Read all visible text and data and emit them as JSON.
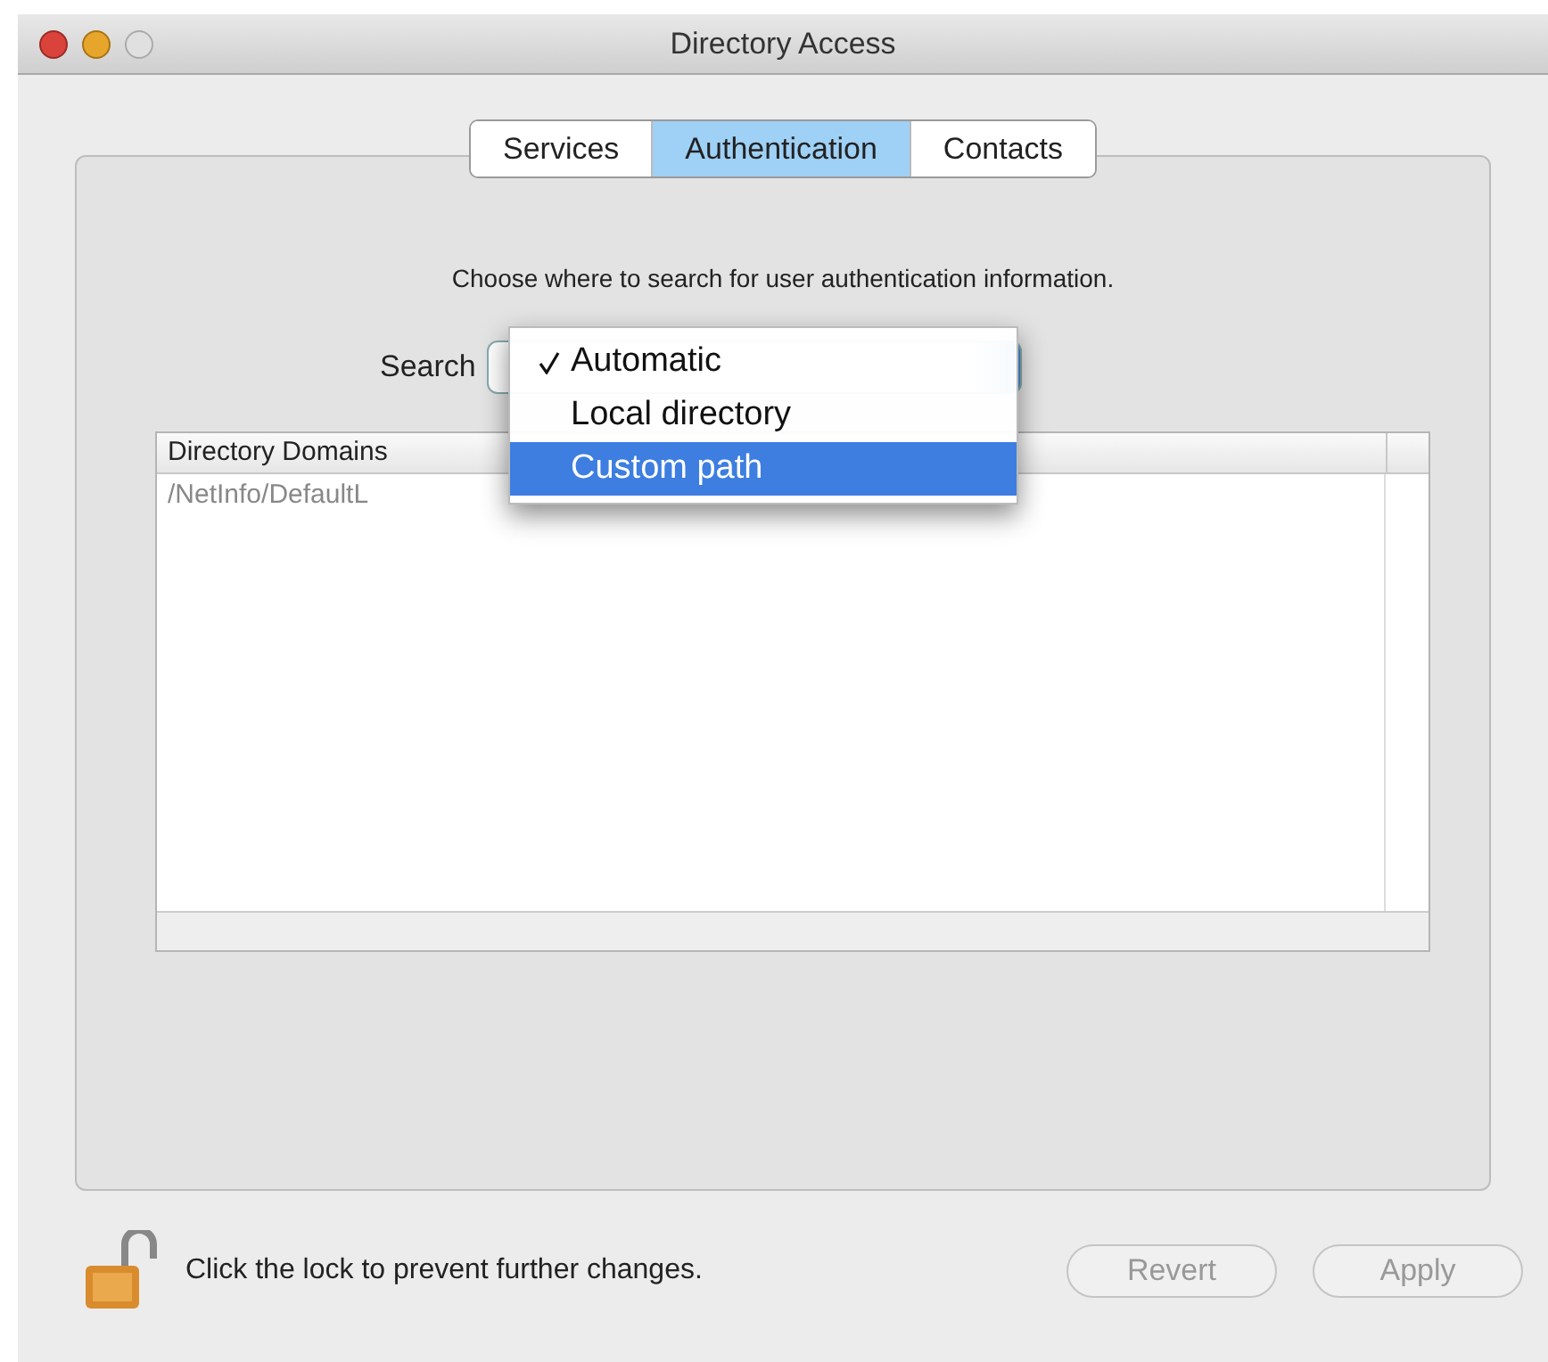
{
  "window": {
    "title": "Directory Access"
  },
  "tabs": [
    {
      "label": "Services",
      "selected": false
    },
    {
      "label": "Authentication",
      "selected": true
    },
    {
      "label": "Contacts",
      "selected": false
    }
  ],
  "instruction": "Choose where to search for user authentication information.",
  "search": {
    "label": "Search",
    "menu": [
      {
        "label": "Automatic",
        "checked": true,
        "selected": false
      },
      {
        "label": "Local directory",
        "checked": false,
        "selected": false
      },
      {
        "label": "Custom path",
        "checked": false,
        "selected": true
      }
    ]
  },
  "table": {
    "columns": [
      "Directory Domains"
    ],
    "rows": [
      "/NetInfo/DefaultL"
    ]
  },
  "lock": {
    "text": "Click the lock to prevent further changes."
  },
  "buttons": [
    {
      "label": "Revert",
      "disabled": true
    },
    {
      "label": "Apply",
      "disabled": true
    }
  ]
}
